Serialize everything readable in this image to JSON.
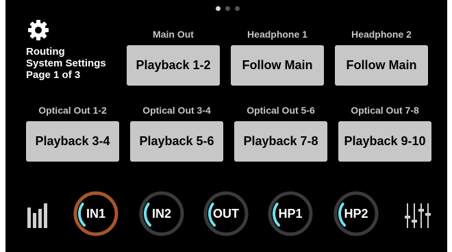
{
  "pager": {
    "total": 3,
    "active": 0
  },
  "info": {
    "line1": "Routing",
    "line2": "System Settings",
    "line3": "Page 1 of 3"
  },
  "outputs": [
    {
      "label": "Main Out",
      "value": "Playback 1-2"
    },
    {
      "label": "Headphone 1",
      "value": "Follow Main"
    },
    {
      "label": "Headphone 2",
      "value": "Follow Main"
    },
    {
      "label": "Optical Out 1-2",
      "value": "Playback 3-4"
    },
    {
      "label": "Optical Out 3-4",
      "value": "Playback 5-6"
    },
    {
      "label": "Optical Out  5-6",
      "value": "Playback 7-8"
    },
    {
      "label": "Optical Out 7-8",
      "value": "Playback 9-10"
    }
  ],
  "knobs": [
    {
      "label": "IN1",
      "level": 0.3,
      "selected": true
    },
    {
      "label": "IN2",
      "level": 0.3,
      "selected": false
    },
    {
      "label": "OUT",
      "level": 0.3,
      "selected": false
    },
    {
      "label": "HP1",
      "level": 0.3,
      "selected": false
    },
    {
      "label": "HP2",
      "level": 0.3,
      "selected": false
    }
  ],
  "icons": {
    "settings": "gear-icon",
    "meters": "level-meter-icon",
    "mixer": "mixer-faders-icon"
  },
  "colors": {
    "background": "#000000",
    "button": "#c7c7c7",
    "label": "#c6c6c6",
    "accent_cyan": "#6ee3f0",
    "ring_selected": "#a8552a",
    "ring_idle": "#3a3a3a"
  }
}
